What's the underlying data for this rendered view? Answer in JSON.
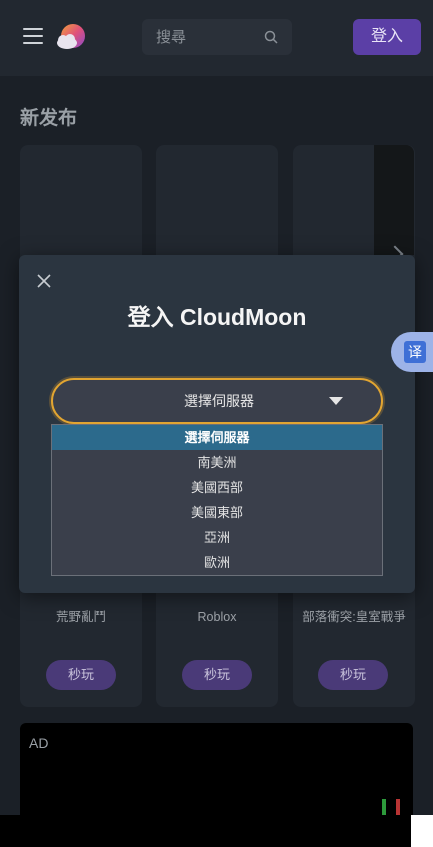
{
  "header": {
    "search_placeholder": "搜尋",
    "login_label": "登入"
  },
  "section": {
    "title": "新发布"
  },
  "games": [
    {
      "name": "荒野亂鬥",
      "play_label": "秒玩"
    },
    {
      "name": "Roblox",
      "play_label": "秒玩"
    },
    {
      "name": "部落衝突:皇室戰爭",
      "play_label": "秒玩"
    }
  ],
  "ad": {
    "label": "AD"
  },
  "modal": {
    "title": "登入 CloudMoon",
    "select": {
      "selected_value": "選擇伺服器",
      "options": [
        "選擇伺服器",
        "南美洲",
        "美國西部",
        "美國東部",
        "亞洲",
        "歐洲"
      ]
    }
  },
  "translate": {
    "label": "译"
  },
  "colors": {
    "accent": "#5b3fa6",
    "select_border": "#e2a531",
    "selected_option": "#2c6a8c"
  }
}
